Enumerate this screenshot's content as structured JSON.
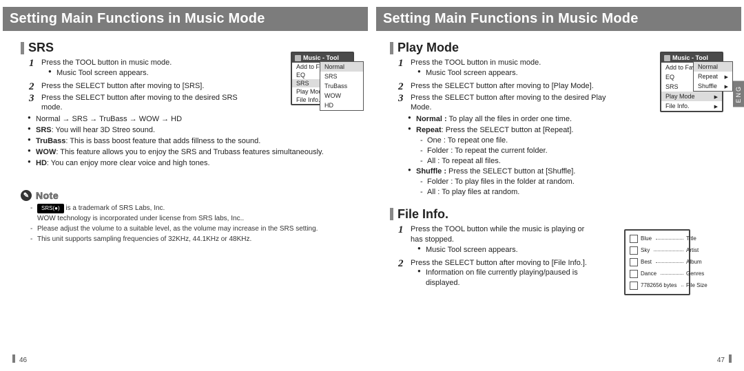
{
  "lang_tab": "ENG",
  "left": {
    "page_title": "Setting Main Functions in Music Mode",
    "srs": {
      "heading": "SRS",
      "step1": "Press the TOOL button in music mode.",
      "step1_sub": "Music Tool screen appears.",
      "step2": "Press the SELECT button after moving to [SRS].",
      "step3": "Press the SELECT button after moving to the desired SRS mode.",
      "chain": "Normal → SRS → TruBass → WOW → HD",
      "desc_srs_label": "SRS",
      "desc_srs": ": You will hear 3D Streo sound.",
      "desc_tru_label": "TruBass",
      "desc_tru": ": This is bass boost feature that adds fillness to the sound.",
      "desc_wow_label": "WOW",
      "desc_wow": ": This feature allows you to enjoy the SRS and Trubass features simultaneously.",
      "desc_hd_label": "HD",
      "desc_hd": ": You can enjoy more clear voice and high tones.",
      "menu_title": "Music - Tool",
      "menu_items": {
        "add": "Add to Favorites",
        "eq": "EQ",
        "srs": "SRS",
        "play": "Play Mode",
        "file": "File Info."
      },
      "dropdown": {
        "normal": "Normal",
        "srs": "SRS",
        "trubass": "TruBass",
        "wow": "WOW",
        "hd": "HD"
      }
    },
    "note": {
      "label": "Note",
      "tm_chip": "SRS(●)",
      "tm_text": " is a trademark of SRS Labs, Inc.",
      "wow_text": "WOW technology is incorporated under license from SRS labs, Inc..",
      "vol_text": "Please adjust the volume to a suitable level, as the volume may increase in the SRS setting.",
      "freq_text": "This unit supports sampling frequencies of 32KHz, 44.1KHz or 48KHz."
    },
    "page_num": "46"
  },
  "right": {
    "page_title": "Setting Main Functions in Music Mode",
    "play": {
      "heading": "Play Mode",
      "step1": "Press the TOOL button in music mode.",
      "step1_sub": "Music Tool screen appears.",
      "step2": "Press the SELECT button after moving to [Play Mode].",
      "step3": "Press the SELECT button after moving to the desired Play Mode.",
      "normal_label": "Normal :",
      "normal_text": " To play all the files in order one time.",
      "repeat_label": "Repeat",
      "repeat_text": ": Press the SELECT button at [Repeat].",
      "repeat_one": "One : To repeat one file.",
      "repeat_folder": "Folder : To repeat the current folder.",
      "repeat_all": "All : To repeat all files.",
      "shuffle_label": "Shuffle :",
      "shuffle_text": " Press the SELECT button at [Shuffle].",
      "shuffle_folder": "Folder : To play files in the folder at random.",
      "shuffle_all": "All : To play files at random.",
      "menu_title": "Music - Tool",
      "menu_items": {
        "add": "Add to Favorites",
        "eq": "EQ",
        "srs": "SRS",
        "play": "Play Mode",
        "file": "File Info."
      },
      "dropdown": {
        "normal": "Normal",
        "repeat": "Repeat",
        "shuffle": "Shuffle"
      }
    },
    "file": {
      "heading": "File Info.",
      "step1": "Press the TOOL button while the music is playing or has stopped.",
      "step1_sub": "Music Tool screen appears.",
      "step2": "Press the SELECT button after moving to [File Info.].",
      "step2_sub": "Information on file currently playing/paused is displayed.",
      "rows": {
        "title_val": "Blue",
        "title_lab": "Title",
        "artist_val": "Sky",
        "artist_lab": "Artist",
        "album_val": "Best",
        "album_lab": "Album",
        "genres_val": "Dance",
        "genres_lab": "Genres",
        "size_val": "7782656 bytes",
        "size_lab": "File Size"
      }
    },
    "page_num": "47"
  }
}
